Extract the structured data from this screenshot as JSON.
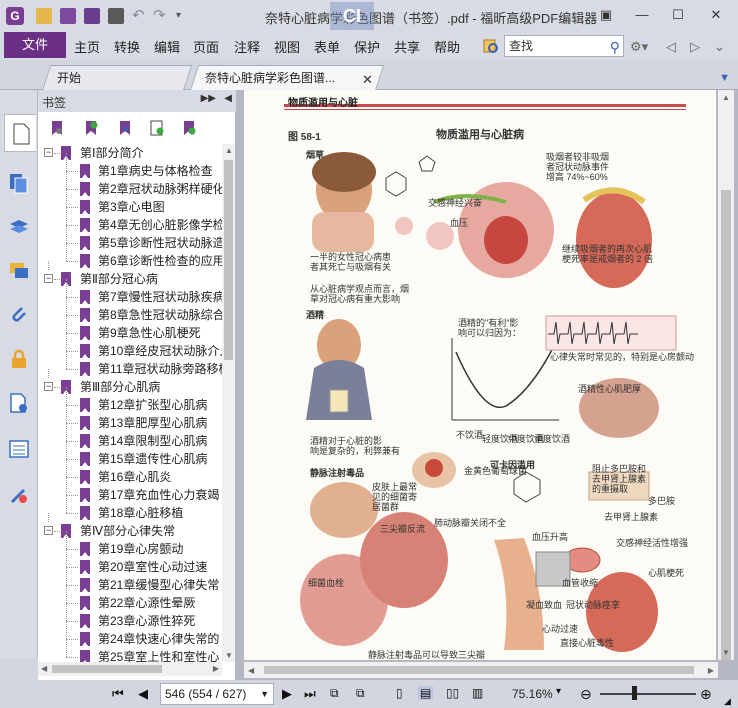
{
  "window": {
    "title": "奈特心脏病学彩色图谱（书签）.pdf - 福昕高级PDF编辑器",
    "minimize": "—",
    "maximize": "☐",
    "close": "✕"
  },
  "menubar": {
    "file": "文件",
    "items": [
      "主页",
      "转换",
      "编辑",
      "页面",
      "注释",
      "视图",
      "表单",
      "保护",
      "共享",
      "帮助"
    ],
    "search_placeholder": "查找"
  },
  "tabs": [
    {
      "label": "开始"
    },
    {
      "label": "奈特心脏病学彩色图谱..."
    }
  ],
  "bookmarks": {
    "panel_title": "书签",
    "items": [
      {
        "level": 0,
        "toggle": "−",
        "label": "第Ⅰ部分简介"
      },
      {
        "level": 1,
        "label": "第1章病史与体格检查"
      },
      {
        "level": 1,
        "label": "第2章冠状动脉粥样硬化"
      },
      {
        "level": 1,
        "label": "第3章心电图"
      },
      {
        "level": 1,
        "label": "第4章无创心脏影像学检"
      },
      {
        "level": 1,
        "label": "第5章诊断性冠状动脉造"
      },
      {
        "level": 1,
        "label": "第6章诊断性检查的应用"
      },
      {
        "level": 0,
        "toggle": "−",
        "label": "第Ⅱ部分冠心病"
      },
      {
        "level": 1,
        "label": "第7章慢性冠状动脉疾病"
      },
      {
        "level": 1,
        "label": "第8章急性冠状动脉综合"
      },
      {
        "level": 1,
        "label": "第9章急性心肌梗死"
      },
      {
        "level": 1,
        "label": "第10章经皮冠状动脉介入"
      },
      {
        "level": 1,
        "label": "第11章冠状动脉旁路移植"
      },
      {
        "level": 0,
        "toggle": "−",
        "label": "第Ⅲ部分心肌病"
      },
      {
        "level": 1,
        "label": "第12章扩张型心肌病"
      },
      {
        "level": 1,
        "label": "第13章肥厚型心肌病"
      },
      {
        "level": 1,
        "label": "第14章限制型心肌病"
      },
      {
        "level": 1,
        "label": "第15章遗传性心肌病"
      },
      {
        "level": 1,
        "label": "第16章心肌炎"
      },
      {
        "level": 1,
        "label": "第17章充血性心力衰竭"
      },
      {
        "level": 1,
        "label": "第18章心脏移植"
      },
      {
        "level": 0,
        "toggle": "−",
        "label": "第Ⅳ部分心律失常"
      },
      {
        "level": 1,
        "label": "第19章心房颤动"
      },
      {
        "level": 1,
        "label": "第20章室性心动过速"
      },
      {
        "level": 1,
        "label": "第21章缓慢型心律失常"
      },
      {
        "level": 1,
        "label": "第22章心源性晕厥"
      },
      {
        "level": 1,
        "label": "第23章心源性猝死"
      },
      {
        "level": 1,
        "label": "第24章快速心律失常的"
      },
      {
        "level": 1,
        "label": "第25章室上性和室性心"
      }
    ]
  },
  "page": {
    "running_head": "物质滥用与心脏",
    "figure_label": "图 58-1",
    "figure_title": "物质滥用与心脏病",
    "smoking_label": "烟草",
    "alcohol_label": "酒精",
    "drug_label": "静脉注射毒品",
    "cocaine_label": "可卡因滥用",
    "smoking_note1": "吸烟者较非吸烟",
    "smoking_note2": "者冠状动脉事件",
    "smoking_note3": "增高 74%~60%",
    "smoking_caption1": "一半的女性冠心病患",
    "smoking_caption2": "者其死亡与吸烟有关",
    "smoking_caption3": "从心脏病学观点而言，烟",
    "smoking_caption4": "草对冠心病有重大影响",
    "passive_note1": "继续吸烟者的再次心肌",
    "passive_note2": "梗死率是戒烟者的 2 倍",
    "nicotine_effect": "交感神经兴奋",
    "bp_effect": "血压",
    "alcohol_caption1": "酒精对于心脏的影",
    "alcohol_caption2": "响是复杂的，利弊兼有",
    "alcohol_curve_note1": "酒精的\"有利\"影",
    "alcohol_curve_note2": "响可以归因为：",
    "alcohol_ecg_note": "心律失常时常见的，特别是心房颤动",
    "alcohol_xaxis": [
      "不饮酒",
      "轻度饮酒",
      "中度饮酒",
      "重度饮酒"
    ],
    "alcohol_cm": "酒精性心肌肥厚",
    "drug_note1": "皮肤上最常",
    "drug_note2": "见的细菌寄",
    "drug_note3": "居菌群",
    "drug_bacteria": "金黄色葡萄球菌",
    "drug_tricuspid": "三尖瓣反流",
    "drug_pulm": "肺动脉瓣关闭不全",
    "drug_emboli": "细菌血栓",
    "drug_caption": "静脉注射毒品可以导致三尖瓣",
    "cocaine_note1": "阻止多巴胺和",
    "cocaine_note2": "去甲肾上腺素",
    "cocaine_note3": "的重摄取",
    "cocaine_dopamine": "多巴胺",
    "cocaine_ne": "去甲肾上腺素",
    "cocaine_sympathetic": "交感神经活性增强",
    "cocaine_bp": "血压升高",
    "cocaine_vasospasm": "血管收缩",
    "cocaine_mi": "心肌梗死",
    "cocaine_thrombus": "凝血致血",
    "cocaine_cas": "冠状动脉痉挛",
    "cocaine_tachy": "心动过速",
    "cocaine_sudden": "直接心脏毒性"
  },
  "status": {
    "page_field": "546 (554 / 627)",
    "zoom": "75.16%"
  }
}
